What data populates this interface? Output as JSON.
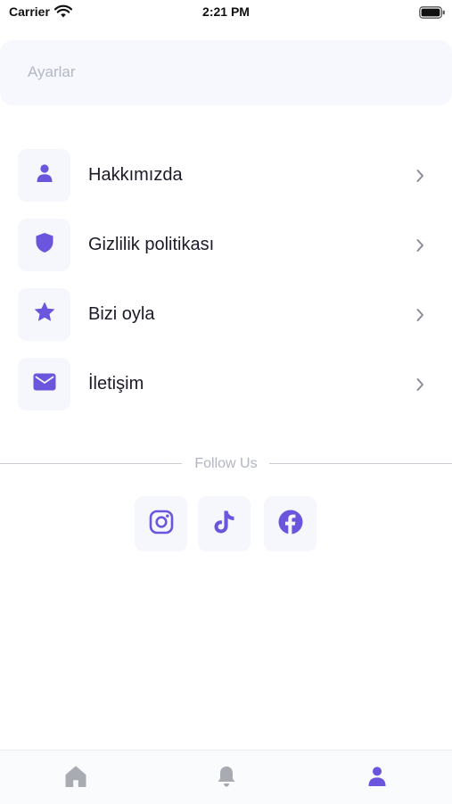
{
  "status_bar": {
    "carrier": "Carrier",
    "time": "2:21 PM",
    "icons": [
      "wifi-icon",
      "battery-icon"
    ]
  },
  "header": {
    "title": "Ayarlar"
  },
  "menu": {
    "items": [
      {
        "label": "Hakkımızda",
        "icon": "person-icon"
      },
      {
        "label": "Gizlilik politikası",
        "icon": "shield-icon"
      },
      {
        "label": "Bizi oyla",
        "icon": "star-icon"
      },
      {
        "label": "İletişim",
        "icon": "mail-icon"
      }
    ]
  },
  "follow": {
    "label": "Follow Us",
    "socials": [
      "instagram-icon",
      "tiktok-icon",
      "facebook-icon"
    ]
  },
  "tabs": [
    {
      "icon": "home-icon",
      "active": false
    },
    {
      "icon": "bell-icon",
      "active": false
    },
    {
      "icon": "person-icon",
      "active": true
    }
  ],
  "colors": {
    "accent": "#6b55dd",
    "inactive": "#a9abb2",
    "card_bg": "#f5f7fd",
    "header_bg": "#f6f8fd"
  }
}
